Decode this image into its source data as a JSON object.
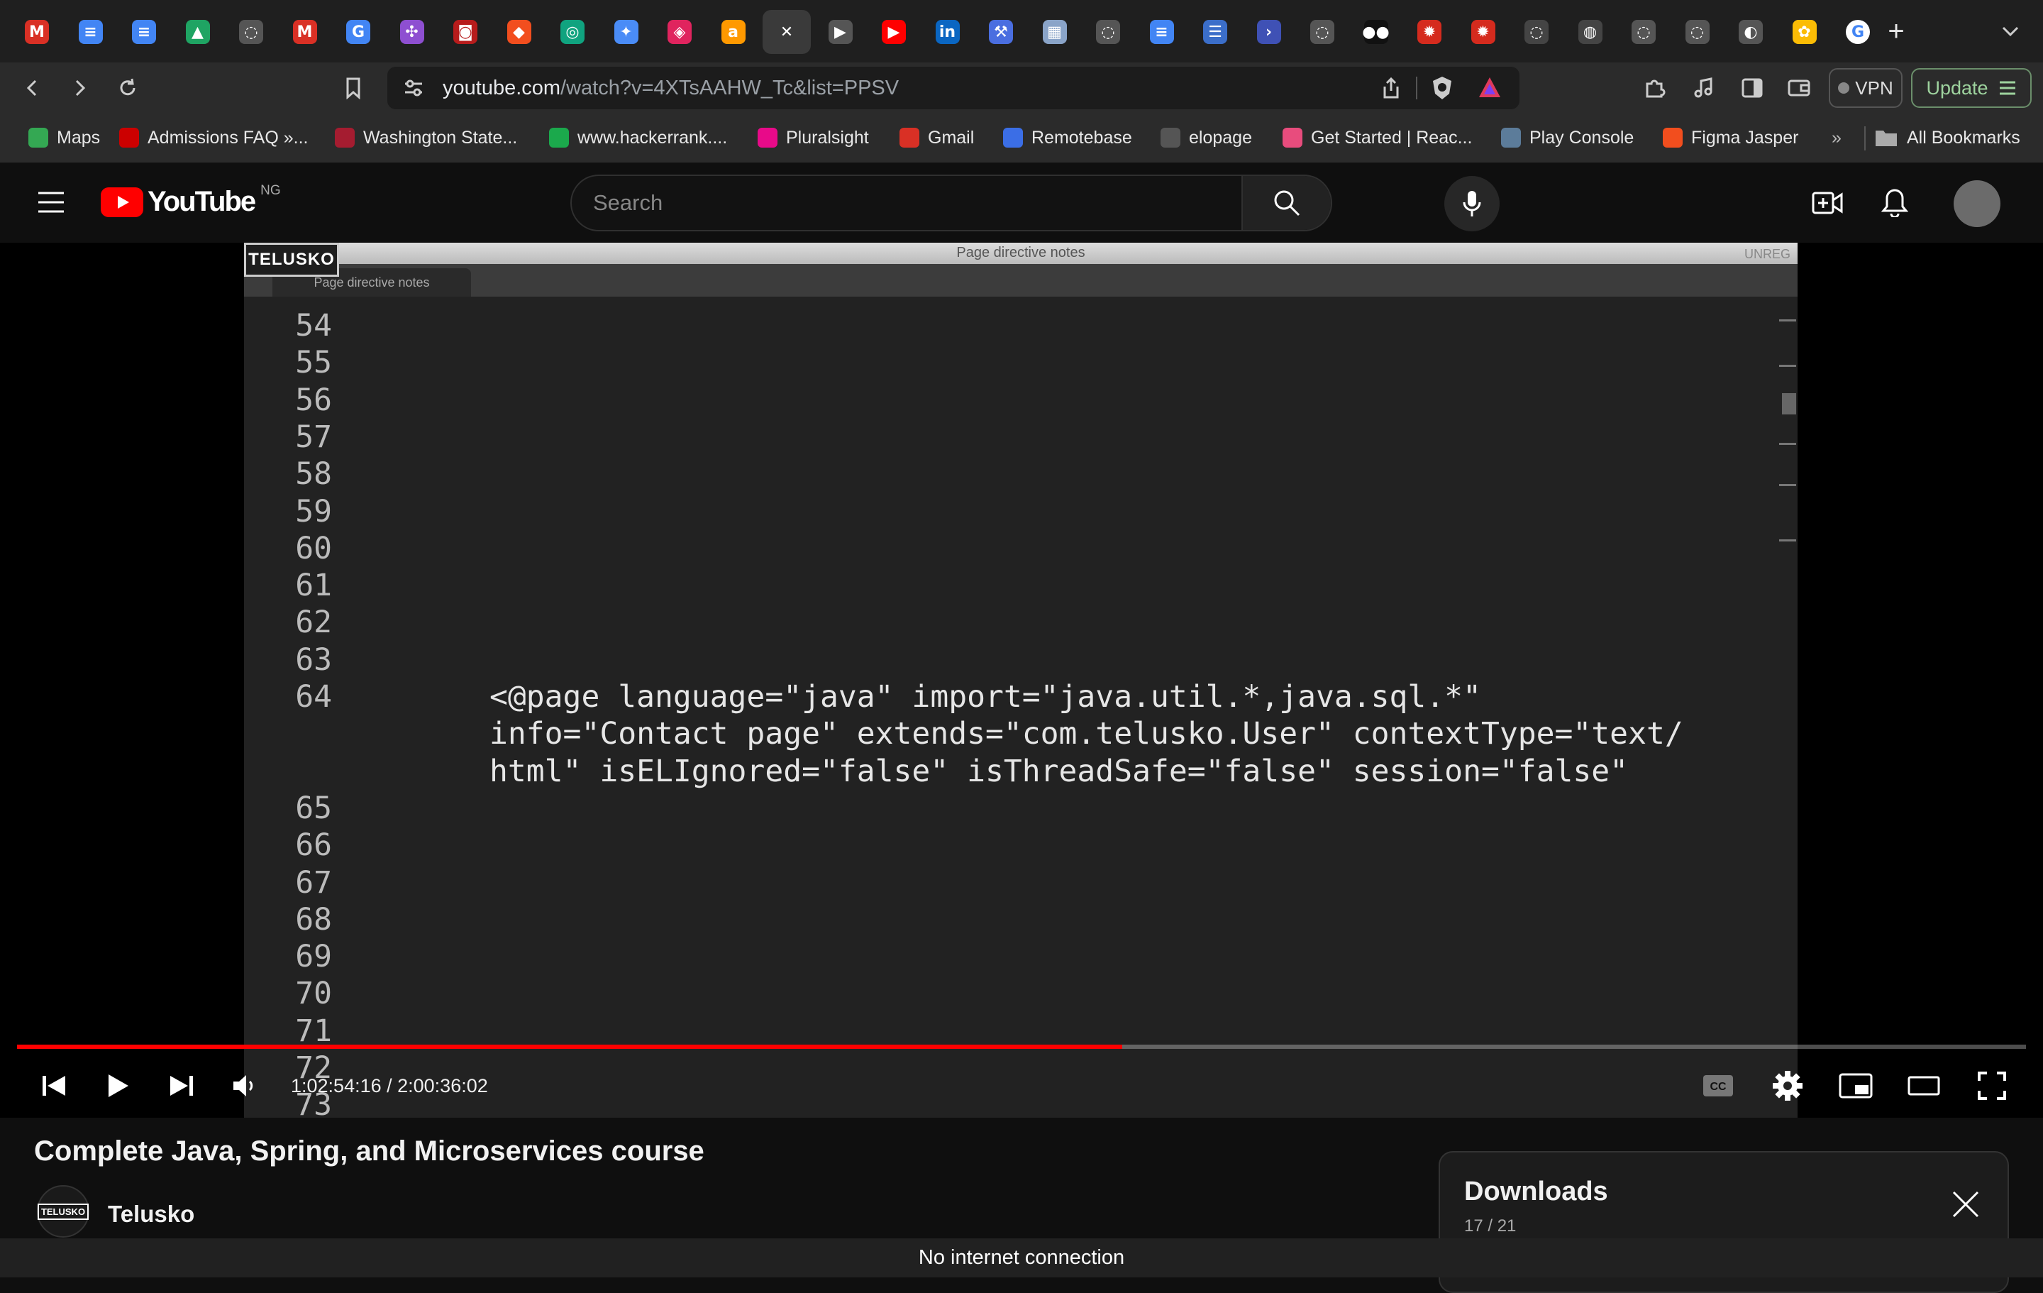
{
  "tabs": [
    {
      "icon": "gmail-icon",
      "glyph": "M",
      "color": "#d93025"
    },
    {
      "icon": "docs-icon",
      "glyph": "≡",
      "color": "#4285f4"
    },
    {
      "icon": "docs-icon",
      "glyph": "≡",
      "color": "#4285f4"
    },
    {
      "icon": "drive-icon",
      "glyph": "▲",
      "color": "#1fa463"
    },
    {
      "icon": "openai-icon",
      "glyph": "◌",
      "color": "#555555"
    },
    {
      "icon": "gmail-icon",
      "glyph": "M",
      "color": "#d93025"
    },
    {
      "icon": "google-icon",
      "glyph": "G",
      "color": "#4285f4"
    },
    {
      "icon": "slack-icon",
      "glyph": "✣",
      "color": "#8e4fd1"
    },
    {
      "icon": "bonfire-icon",
      "glyph": "◙",
      "color": "#b71c1c"
    },
    {
      "icon": "figma-icon",
      "glyph": "◆",
      "color": "#f24e1e"
    },
    {
      "icon": "chatgpt-icon",
      "glyph": "◎",
      "color": "#10a37f"
    },
    {
      "icon": "gemini-icon",
      "glyph": "✦",
      "color": "#4a8cf7"
    },
    {
      "icon": "perplexity-icon",
      "glyph": "◈",
      "color": "#e0245e"
    },
    {
      "icon": "amazon-icon",
      "glyph": "a",
      "color": "#ff9900"
    },
    {
      "icon": "close-icon",
      "glyph": "✕",
      "color": "#3a3a3a",
      "active": true
    },
    {
      "icon": "youtube-icon",
      "glyph": "▶",
      "color": "#555555"
    },
    {
      "icon": "youtube-icon",
      "glyph": "▶",
      "color": "#ff0000"
    },
    {
      "icon": "linkedin-icon",
      "glyph": "in",
      "color": "#0a66c2"
    },
    {
      "icon": "tools-icon",
      "glyph": "⚒",
      "color": "#4a6ee0"
    },
    {
      "icon": "image-icon",
      "glyph": "▦",
      "color": "#8aa4c8"
    },
    {
      "icon": "openai-icon",
      "glyph": "◌",
      "color": "#555555"
    },
    {
      "icon": "docs-icon",
      "glyph": "≡",
      "color": "#4285f4"
    },
    {
      "icon": "list-icon",
      "glyph": "☰",
      "color": "#3b6ec9"
    },
    {
      "icon": "terminal-icon",
      "glyph": "›",
      "color": "#3f51b5"
    },
    {
      "icon": "openai-icon",
      "glyph": "◌",
      "color": "#555555"
    },
    {
      "icon": "medium-icon",
      "glyph": "●●",
      "color": "#111111"
    },
    {
      "icon": "maple-leaf-icon",
      "glyph": "✹",
      "color": "#d52b1e"
    },
    {
      "icon": "maple-leaf-icon",
      "glyph": "✹",
      "color": "#d52b1e"
    },
    {
      "icon": "loading-icon",
      "glyph": "◌",
      "color": "#444444"
    },
    {
      "icon": "github-icon",
      "glyph": "◍",
      "color": "#444444"
    },
    {
      "icon": "openai-icon",
      "glyph": "◌",
      "color": "#555555"
    },
    {
      "icon": "openai-icon",
      "glyph": "◌",
      "color": "#555555"
    },
    {
      "icon": "globe-icon",
      "glyph": "◐",
      "color": "#555555"
    },
    {
      "icon": "photos-icon",
      "glyph": "✿",
      "color": "#fbbc05"
    },
    {
      "icon": "google-icon",
      "glyph": "G",
      "color": "#ffffff"
    }
  ],
  "address": {
    "domain": "youtube.com",
    "path": "/watch?v=4XTsAAHW_Tc&list=PPSV"
  },
  "toolbar": {
    "vpn_label": "VPN",
    "update_label": "Update"
  },
  "bookmarks": [
    {
      "label": "Maps",
      "color": "#34a853"
    },
    {
      "label": "Admissions FAQ »...",
      "color": "#cc0000"
    },
    {
      "label": "Washington State...",
      "color": "#a51c30"
    },
    {
      "label": "www.hackerrank....",
      "color": "#1ba94c"
    },
    {
      "label": "Pluralsight",
      "color": "#e80a89"
    },
    {
      "label": "Gmail",
      "color": "#d93025"
    },
    {
      "label": "Remotebase",
      "color": "#3b6ee6"
    },
    {
      "label": "elopage",
      "color": "#555555"
    },
    {
      "label": "Get Started | Reac...",
      "color": "#e84c7d"
    },
    {
      "label": "Play Console",
      "color": "#5c7c9a"
    },
    {
      "label": "Figma Jasper",
      "color": "#f24e1e"
    }
  ],
  "bookmarks_more": "»",
  "bookmarks_all": "All Bookmarks",
  "youtube": {
    "logo_text": "YouTube",
    "country": "NG",
    "search_placeholder": "Search"
  },
  "video": {
    "watermark": "TELUSKO",
    "window_title": "Page directive notes",
    "window_badge": "UNREG",
    "tab_label": "Page directive notes",
    "line_numbers_top": [
      "54",
      "55",
      "56",
      "57",
      "58",
      "59",
      "60",
      "61",
      "62",
      "63",
      "64"
    ],
    "code_lines": [
      "<@page language=\"java\" import=\"java.util.*,java.sql.*\"",
      "info=\"Contact page\" extends=\"com.telusko.User\" contextType=\"text/",
      "html\" isELIgnored=\"false\" isThreadSafe=\"false\" session=\"false\""
    ],
    "line_numbers_bottom": [
      "65",
      "66",
      "67",
      "68",
      "69",
      "70",
      "71",
      "72",
      "73"
    ]
  },
  "player": {
    "time": "1:02:54:16 / 2:00:36:02",
    "progress": 0.55
  },
  "title": "Complete Java, Spring, and Microservices course",
  "channel": {
    "name": "Telusko",
    "avatar_text": "TELUSKO"
  },
  "downloads": {
    "title": "Downloads",
    "count": "17 / 21"
  },
  "status": "No internet connection"
}
